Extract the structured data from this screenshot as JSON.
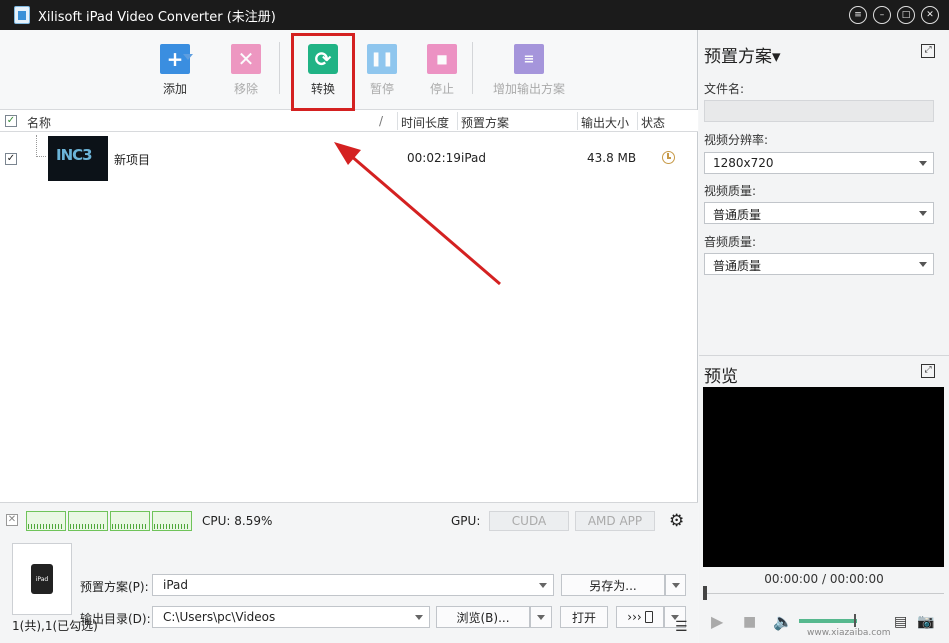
{
  "window": {
    "title": "Xilisoft iPad Video Converter (未注册)"
  },
  "toolbar": {
    "add": "添加",
    "remove": "移除",
    "convert": "转换",
    "pause": "暂停",
    "stop": "停止",
    "add_output_profile": "增加输出方案"
  },
  "columns": {
    "name": "名称",
    "slash": "/",
    "duration": "时间长度",
    "profile": "预置方案",
    "output_size": "输出大小",
    "status": "状态"
  },
  "files": [
    {
      "name": "新项目",
      "thumb_text": "INC3",
      "duration": "00:02:19",
      "profile": "iPad",
      "size": "43.8 MB",
      "checked": true
    }
  ],
  "monitor": {
    "cpu": "CPU: 8.59%",
    "gpu": "GPU:",
    "cuda": "CUDA",
    "amd": "AMD APP"
  },
  "bottom": {
    "device_icon_text": "iPad",
    "profile_label": "预置方案(P):",
    "profile_value": "iPad",
    "save_as": "另存为...",
    "dest_label": "输出目录(D):",
    "dest_value": "C:\\Users\\pc\\Videos",
    "browse": "浏览(B)...",
    "open": "打开",
    "transfer": "›››"
  },
  "statusbar": {
    "text": "1(共),1(已勾选)"
  },
  "right_panel": {
    "title": "预置方案▾",
    "filename_label": "文件名:",
    "filename_value": "",
    "resolution_label": "视频分辨率:",
    "resolution_value": "1280x720",
    "video_quality_label": "视频质量:",
    "video_quality_value": "普通质量",
    "audio_quality_label": "音频质量:",
    "audio_quality_value": "普通质量",
    "preview_title": "预览",
    "timecode": "00:00:00 / 00:00:00"
  },
  "watermark": "www.xiazaiba.com"
}
